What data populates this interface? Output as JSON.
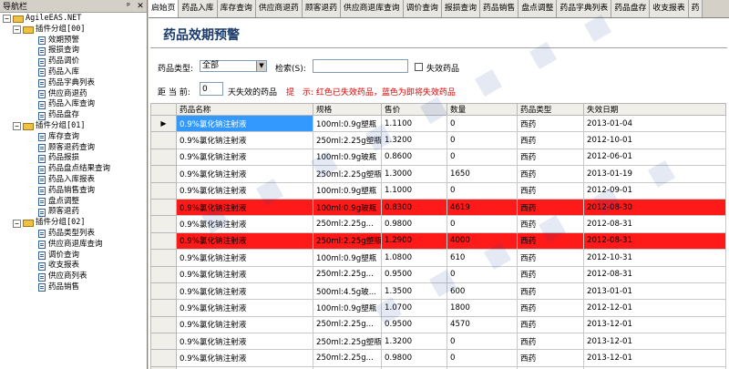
{
  "nav": {
    "title": "导航栏",
    "pin_symbol": "ᵖ",
    "close_symbol": "✕",
    "root": "AgileEAS.NET",
    "groups": [
      {
        "label": "插件分组[00]",
        "items": [
          "效期预警",
          "报损查询",
          "药品调价",
          "药品入库",
          "药品字典列表",
          "供应商退药",
          "药品入库查询",
          "药品盘存"
        ]
      },
      {
        "label": "插件分组[01]",
        "items": [
          "库存查询",
          "顾客退药查询",
          "药品报损",
          "药品盘点结果查询",
          "药品入库报表",
          "药品销售查询",
          "盘点调整",
          "顾客退药"
        ]
      },
      {
        "label": "插件分组[02]",
        "items": [
          "药品类型列表",
          "供应商退库查询",
          "调价查询",
          "收支报表",
          "供应商列表",
          "药品销售"
        ]
      }
    ]
  },
  "tabs": [
    "启始页",
    "药品入库",
    "库存查询",
    "供应商退药",
    "顾客退药",
    "供应商退库查询",
    "调价查询",
    "报损查询",
    "药品销售",
    "盘点调整",
    "药品字典列表",
    "药品盘存",
    "收支报表",
    "药"
  ],
  "main": {
    "title": "药品效期预警",
    "filter": {
      "type_label": "药品类型:",
      "type_value": "全部",
      "search_label": "检索(S):",
      "search_value": "",
      "expired_label": "失效药品",
      "days_prefix": "距 当 前:",
      "days_value": "0",
      "days_suffix": "天失效的药品",
      "hint": "提　示: 红色已失效药品，蓝色为即将失效药品"
    },
    "columns": [
      "药品名称",
      "规格",
      "售价",
      "数量",
      "药品类型",
      "失效日期"
    ]
  },
  "grid": {
    "rows": [
      {
        "name": "0.9%氯化钠注射液",
        "spec": "100ml:0.9g塑瓶",
        "price": "1.1100",
        "qty": "0",
        "type": "西药",
        "expiry": "2013-01-04",
        "state": "current"
      },
      {
        "name": "0.9%氯化钠注射液",
        "spec": "250ml:2.25g塑瓶",
        "price": "1.3200",
        "qty": "0",
        "type": "西药",
        "expiry": "2012-10-01",
        "state": "normal"
      },
      {
        "name": "0.9%氯化钠注射液",
        "spec": "100ml:0.9g玻瓶",
        "price": "0.8600",
        "qty": "0",
        "type": "西药",
        "expiry": "2012-06-01",
        "state": "normal"
      },
      {
        "name": "0.9%氯化钠注射液",
        "spec": "250ml:2.25g塑瓶",
        "price": "1.3000",
        "qty": "1650",
        "type": "西药",
        "expiry": "2013-01-19",
        "state": "normal"
      },
      {
        "name": "0.9%氯化钠注射液",
        "spec": "100ml:0.9g塑瓶",
        "price": "1.1000",
        "qty": "0",
        "type": "西药",
        "expiry": "2012-09-01",
        "state": "normal"
      },
      {
        "name": "0.9%氯化钠注射液",
        "spec": "100ml:0.9g玻瓶",
        "price": "0.8300",
        "qty": "4619",
        "type": "西药",
        "expiry": "2012-08-30",
        "state": "expired"
      },
      {
        "name": "0.9%氯化钠注射液",
        "spec": "250ml:2.25g...",
        "price": "0.9800",
        "qty": "0",
        "type": "西药",
        "expiry": "2012-08-31",
        "state": "normal"
      },
      {
        "name": "0.9%氯化钠注射液",
        "spec": "250ml:2.25g塑瓶",
        "price": "1.2900",
        "qty": "4000",
        "type": "西药",
        "expiry": "2012-08-31",
        "state": "expired"
      },
      {
        "name": "0.9%氯化钠注射液",
        "spec": "100ml:0.9g塑瓶",
        "price": "1.0800",
        "qty": "610",
        "type": "西药",
        "expiry": "2012-10-31",
        "state": "normal"
      },
      {
        "name": "0.9%氯化钠注射液",
        "spec": "250ml:2.25g...",
        "price": "0.9500",
        "qty": "0",
        "type": "西药",
        "expiry": "2012-08-31",
        "state": "normal"
      },
      {
        "name": "0.9%氯化钠注射液",
        "spec": "500ml:4.5g玻...",
        "price": "1.3500",
        "qty": "600",
        "type": "西药",
        "expiry": "2013-01-01",
        "state": "normal"
      },
      {
        "name": "0.9%氯化钠注射液",
        "spec": "100ml:0.9g塑瓶",
        "price": "1.0700",
        "qty": "1800",
        "type": "西药",
        "expiry": "2012-12-01",
        "state": "normal"
      },
      {
        "name": "0.9%氯化钠注射液",
        "spec": "250ml:2.25g...",
        "price": "0.9500",
        "qty": "4570",
        "type": "西药",
        "expiry": "2013-12-01",
        "state": "normal"
      },
      {
        "name": "0.9%氯化钠注射液",
        "spec": "250ml:2.25g塑瓶",
        "price": "1.3200",
        "qty": "0",
        "type": "西药",
        "expiry": "2013-12-01",
        "state": "normal"
      },
      {
        "name": "0.9%氯化钠注射液",
        "spec": "250ml:2.25g...",
        "price": "0.9800",
        "qty": "0",
        "type": "西药",
        "expiry": "2013-12-01",
        "state": "normal"
      },
      {
        "name": "0.9%氯化钠注射液",
        "spec": "100ml:0.9g塑瓶",
        "price": "0.9900",
        "qty": "0",
        "type": "西药",
        "expiry": "2013-12-01",
        "state": "normal"
      }
    ]
  },
  "colors": {
    "expired": "#ff1a1a",
    "selected": "#3399ff",
    "title": "#1a3a6a",
    "hint": "#e00000"
  }
}
